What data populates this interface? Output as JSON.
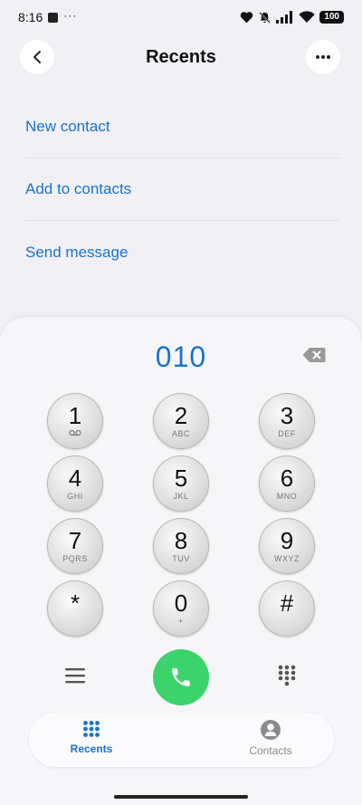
{
  "status_bar": {
    "time": "8:16",
    "dots": "···",
    "battery": "100"
  },
  "header": {
    "title": "Recents"
  },
  "actions": [
    {
      "label": "New contact"
    },
    {
      "label": "Add to contacts"
    },
    {
      "label": "Send message"
    }
  ],
  "dialer": {
    "number": "010",
    "keys": [
      {
        "digit": "1",
        "letters": ""
      },
      {
        "digit": "2",
        "letters": "ABC"
      },
      {
        "digit": "3",
        "letters": "DEF"
      },
      {
        "digit": "4",
        "letters": "GHI"
      },
      {
        "digit": "5",
        "letters": "JKL"
      },
      {
        "digit": "6",
        "letters": "MNO"
      },
      {
        "digit": "7",
        "letters": "PQRS"
      },
      {
        "digit": "8",
        "letters": "TUV"
      },
      {
        "digit": "9",
        "letters": "WXYZ"
      },
      {
        "digit": "*",
        "letters": ""
      },
      {
        "digit": "0",
        "letters": "+"
      },
      {
        "digit": "#",
        "letters": ""
      }
    ]
  },
  "nav": {
    "recents": "Recents",
    "contacts": "Contacts"
  },
  "colors": {
    "accent": "#1a73c9",
    "call": "#3dd36c",
    "background": "#f0f0f5"
  }
}
